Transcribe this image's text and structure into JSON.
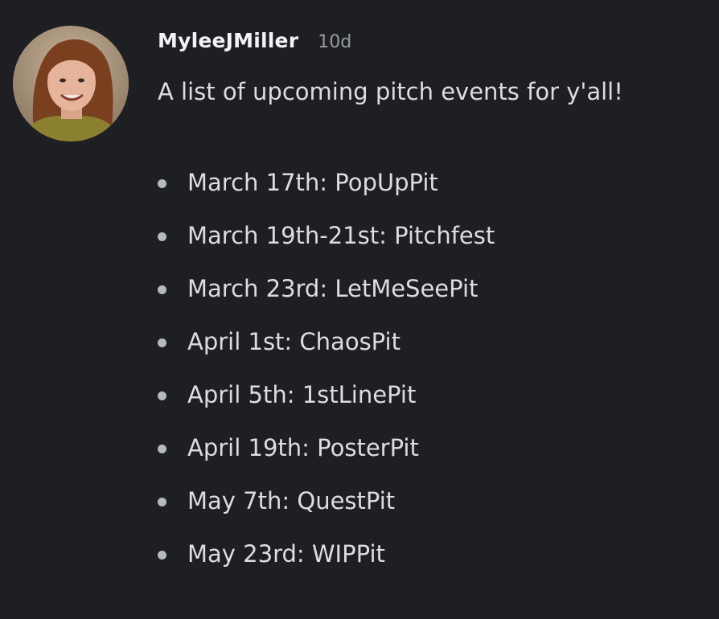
{
  "message": {
    "author": "MyleeJMiller",
    "timestamp": "10d",
    "text": "A list of upcoming pitch events for y'all!",
    "events": [
      "March 17th: PopUpPit",
      "March 19th-21st: Pitchfest",
      "March 23rd: LetMeSeePit",
      "April 1st: ChaosPit",
      "April 5th: 1stLinePit",
      "April 19th: PosterPit",
      "May 7th: QuestPit",
      "May 23rd: WIPPit"
    ]
  },
  "colors": {
    "background": "#1e1f22",
    "username": "#f2f3f5",
    "timestamp": "#949ba4",
    "text": "#dbdee1",
    "bullet": "#b5bac1"
  }
}
